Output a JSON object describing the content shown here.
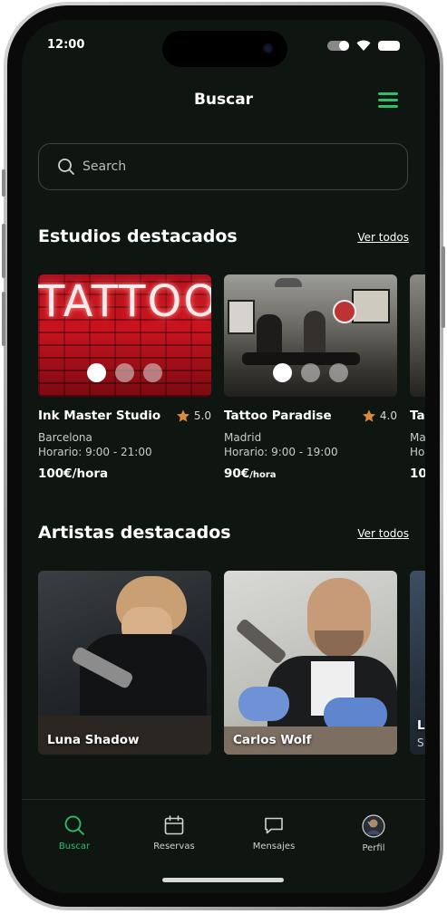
{
  "status_bar": {
    "time": "12:00"
  },
  "header": {
    "title": "Buscar"
  },
  "search": {
    "placeholder": "Search"
  },
  "studios_section": {
    "title": "Estudios destacados",
    "see_all": "Ver todos",
    "items": [
      {
        "name": "Ink Master Studio",
        "rating": "5.0",
        "city": "Barcelona",
        "hours": "Horario: 9:00 - 21:00",
        "price": "100€",
        "price_unit": "/hora",
        "image_text": "TATTOO"
      },
      {
        "name": "Tattoo Paradise",
        "rating": "4.0",
        "city": "Madrid",
        "hours": "Horario: 9:00 - 19:00",
        "price": "90€",
        "price_unit": "/hora"
      },
      {
        "name": "Ta",
        "city": "Ma",
        "hours": "Ho",
        "price": "10"
      }
    ]
  },
  "artists_section": {
    "title": "Artistas destacados",
    "see_all": "Ver todos",
    "items": [
      {
        "name": "Luna Shadow"
      },
      {
        "name": "Carlos Wolf"
      },
      {
        "name": "L",
        "subtitle": "S"
      }
    ]
  },
  "tabbar": {
    "items": [
      {
        "label": "Buscar",
        "icon": "search-icon",
        "active": true
      },
      {
        "label": "Reservas",
        "icon": "calendar-icon",
        "active": false
      },
      {
        "label": "Mensajes",
        "icon": "message-icon",
        "active": false
      },
      {
        "label": "Perfil",
        "icon": "avatar",
        "active": false
      }
    ]
  },
  "colors": {
    "accent": "#2fbf6a",
    "background": "#0f1612",
    "star": "#d98a3f"
  }
}
